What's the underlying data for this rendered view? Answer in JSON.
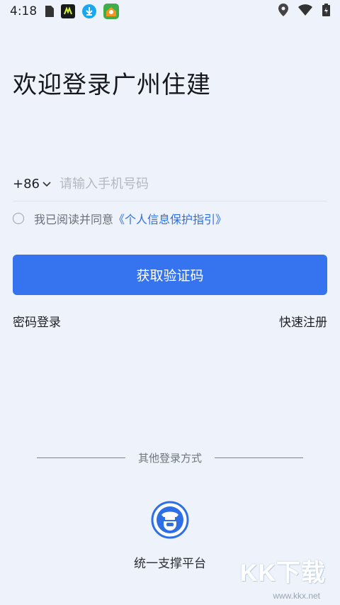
{
  "status_bar": {
    "time": "4:18",
    "icons": [
      "sim-card-icon",
      "app-icon",
      "download-icon",
      "home-app-icon",
      "location-icon",
      "wifi-icon",
      "battery-icon"
    ]
  },
  "login": {
    "title": "欢迎登录广州住建",
    "country_code": "+86",
    "phone_placeholder": "请输入手机号码",
    "agree_text": "我已阅读并同意",
    "policy_link": "《个人信息保护指引》",
    "submit_label": "获取验证码",
    "password_login": "密码登录",
    "register": "快速注册"
  },
  "other_login": {
    "divider_text": "其他登录方式",
    "platform_label": "统一支撑平台"
  },
  "watermark": {
    "text": "KK下载",
    "url": "www.kkx.net"
  },
  "colors": {
    "background": "#eef3fb",
    "primary": "#3574ee",
    "link": "#2f6fe4"
  }
}
